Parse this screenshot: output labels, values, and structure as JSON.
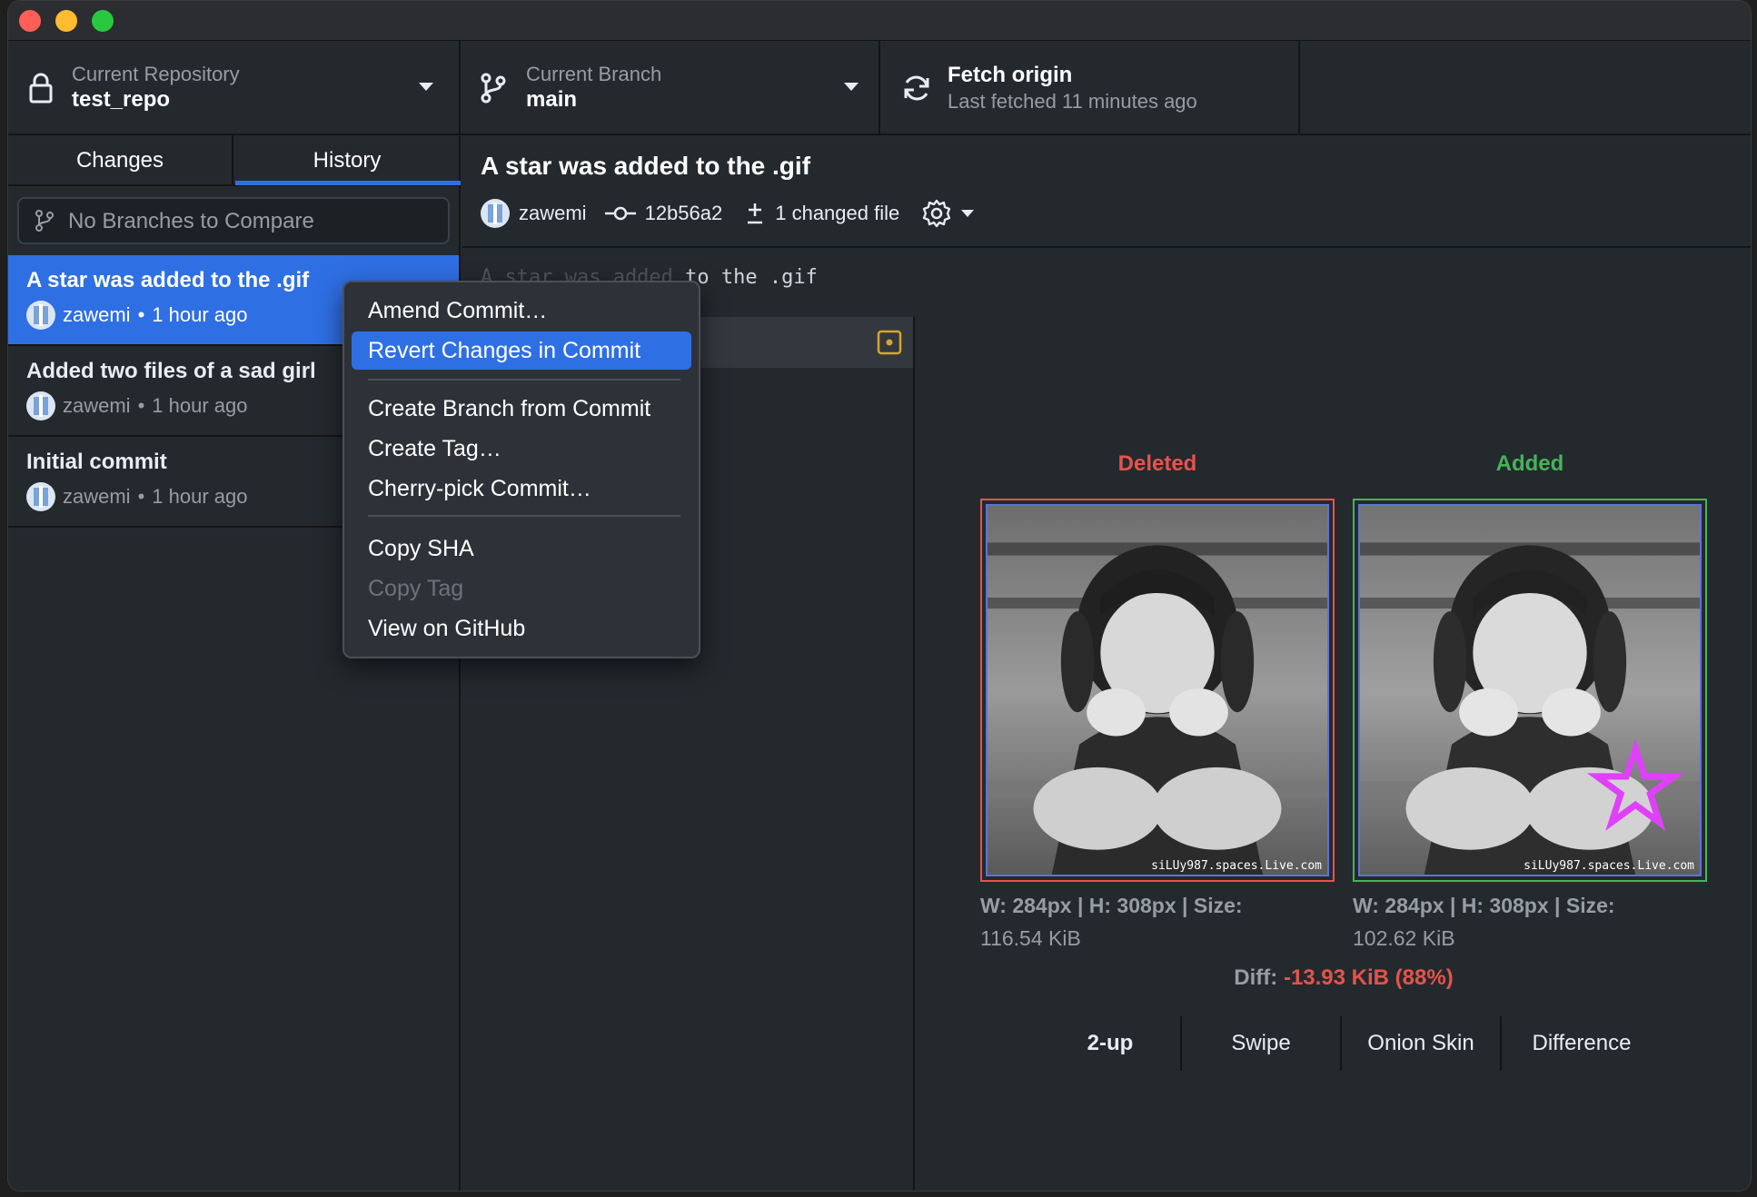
{
  "toolbar": {
    "repo_label": "Current Repository",
    "repo_value": "test_repo",
    "branch_label": "Current Branch",
    "branch_value": "main",
    "fetch_label": "Fetch origin",
    "fetch_sub": "Last fetched 11 minutes ago"
  },
  "sidebar": {
    "tabs": [
      "Changes",
      "History"
    ],
    "active_tab": "History",
    "compare_placeholder": "No Branches to Compare",
    "commits": [
      {
        "title": "A star was added to the .gif",
        "author": "zawemi",
        "sep": "•",
        "time": "1 hour ago"
      },
      {
        "title": "Added two files of a sad girl",
        "author": "zawemi",
        "sep": "•",
        "time": "1 hour ago"
      },
      {
        "title": "Initial commit",
        "author": "zawemi",
        "sep": "•",
        "time": "1 hour ago"
      }
    ]
  },
  "commit_detail": {
    "title": "A star was added to the .gif",
    "author": "zawemi",
    "sha": "12b56a2",
    "changed": "1 changed file",
    "message_visible": "to the .gif"
  },
  "context_menu": {
    "items": [
      {
        "label": "Amend Commit…",
        "state": "normal"
      },
      {
        "label": "Revert Changes in Commit",
        "state": "highlighted"
      },
      {
        "label": "Create Branch from Commit",
        "state": "normal"
      },
      {
        "label": "Create Tag…",
        "state": "normal"
      },
      {
        "label": "Cherry-pick Commit…",
        "state": "normal"
      },
      {
        "label": "Copy SHA",
        "state": "normal"
      },
      {
        "label": "Copy Tag",
        "state": "disabled"
      },
      {
        "label": "View on GitHub",
        "state": "normal"
      }
    ]
  },
  "diff": {
    "deleted_label": "Deleted",
    "added_label": "Added",
    "watermark": "siLUy987.spaces.Live.com",
    "deleted_stats_line1": "W: 284px | H: 308px | Size:",
    "deleted_stats_line2": "116.54 KiB",
    "added_stats_line1": "W: 284px | H: 308px | Size:",
    "added_stats_line2": "102.62 KiB",
    "diff_label": "Diff:",
    "diff_value": "-13.93 KiB (88%)",
    "modes": [
      "2-up",
      "Swipe",
      "Onion Skin",
      "Difference"
    ],
    "active_mode": "2-up"
  },
  "colors": {
    "accent_blue": "#2f6fe4",
    "deleted_red": "#e5534b",
    "added_green": "#46b35a",
    "file_modified_yellow": "#d4a72c",
    "star_magenta": "#e040fb"
  }
}
